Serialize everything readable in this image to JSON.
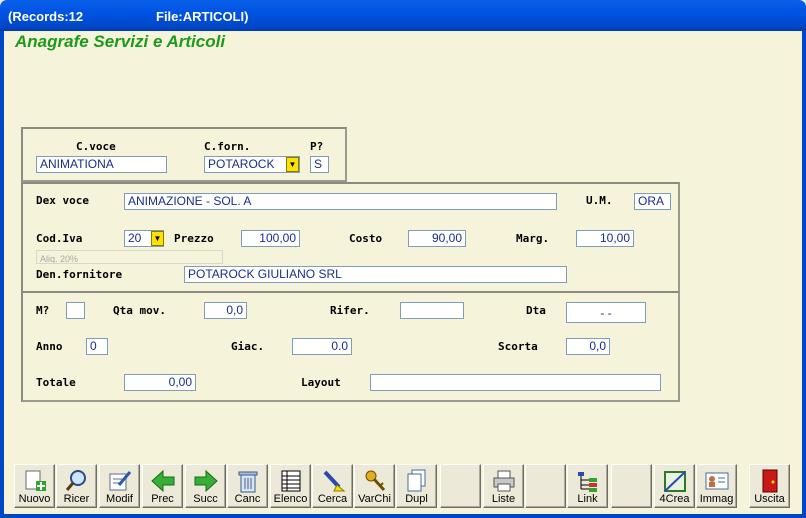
{
  "window": {
    "records": "(Records:12",
    "file": "File:ARTICOLI)"
  },
  "heading": "Anagrafe Servizi e Articoli",
  "key": {
    "voce_label": "C.voce",
    "voce_value": "ANIMATIONA",
    "forn_label": "C.forn.",
    "forn_value": "POTAROCK",
    "p_label": "P?",
    "p_value": "S"
  },
  "details": {
    "dex_label": "Dex voce",
    "dex_value": "ANIMAZIONE - SOL. A",
    "um_label": "U.M.",
    "um_value": "ORA",
    "iva_label": "Cod.Iva",
    "iva_value": "20",
    "aliq_text": "Aliq. 20%",
    "prezzo_label": "Prezzo",
    "prezzo_value": "100,00",
    "costo_label": "Costo",
    "costo_value": "90,00",
    "marg_label": "Marg.",
    "marg_value": "10,00",
    "den_label": "Den.fornitore",
    "den_value": "POTAROCK GIULIANO SRL"
  },
  "stock": {
    "m_label": "M?",
    "m_value": "",
    "qta_label": "Qta mov.",
    "qta_value": "0,0",
    "rifer_label": "Rifer.",
    "rifer_value": "",
    "dta_label": "Dta",
    "dta_value": "-    -",
    "anno_label": "Anno",
    "anno_value": "0",
    "giac_label": "Giac.",
    "giac_value": "0.0",
    "scorta_label": "Scorta",
    "scorta_value": "0,0",
    "totale_label": "Totale",
    "totale_value": "0,00",
    "layout_label": "Layout",
    "layout_value": ""
  },
  "toolbar": {
    "nuovo": "Nuovo",
    "ricer": "Ricer",
    "modif": "Modif",
    "prec": "Prec",
    "succ": "Succ",
    "canc": "Canc",
    "elenco": "Elenco",
    "cerca": "Cerca",
    "varchi": "VarChi",
    "dupl": "Dupl",
    "liste": "Liste",
    "link": "Link",
    "crea": "4Crea",
    "immag": "Immag",
    "uscita": "Uscita"
  },
  "colors": {
    "heading": "#1d9a1d",
    "field_text": "#1a2c8c",
    "dropdown": "#ffe100",
    "titlebar": "#0054e3"
  },
  "icons": {
    "nuovo": "new-document-plus-icon",
    "ricer": "magnifier-icon",
    "modif": "edit-document-icon",
    "prec": "green-left-arrow-icon",
    "succ": "green-right-arrow-icon",
    "canc": "trash-can-icon",
    "elenco": "list-grid-icon",
    "cerca": "search-highlighter-icon",
    "varchi": "keys-icon",
    "dupl": "duplicate-pages-icon",
    "liste": "printer-icon",
    "link": "tree-link-icon",
    "crea": "ruler-square-icon",
    "immag": "id-card-icon",
    "uscita": "exit-door-icon"
  }
}
